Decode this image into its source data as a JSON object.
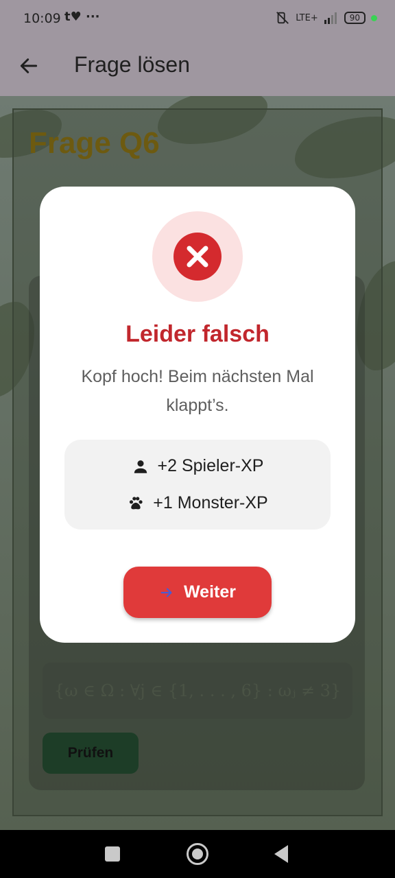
{
  "status": {
    "time": "10:09",
    "notif": "t♥ ···",
    "net": "LTE+",
    "battery": "90"
  },
  "appbar": {
    "title": "Frage lösen"
  },
  "background": {
    "question_title": "Frage Q6",
    "formula": "{ω ∈ Ω : ∀j ∈ {1, . . . , 6} : ωⱼ ≠ 3}",
    "check_label": "Prüfen"
  },
  "dialog": {
    "title": "Leider falsch",
    "subtitle": "Kopf hoch! Beim nächsten Mal klappt’s.",
    "player_xp": "+2 Spieler-XP",
    "monster_xp": "+1 Monster-XP",
    "next_label": "Weiter"
  },
  "colors": {
    "error": "#d42a2e",
    "button": "#e03a3a",
    "title": "#c1272d"
  }
}
